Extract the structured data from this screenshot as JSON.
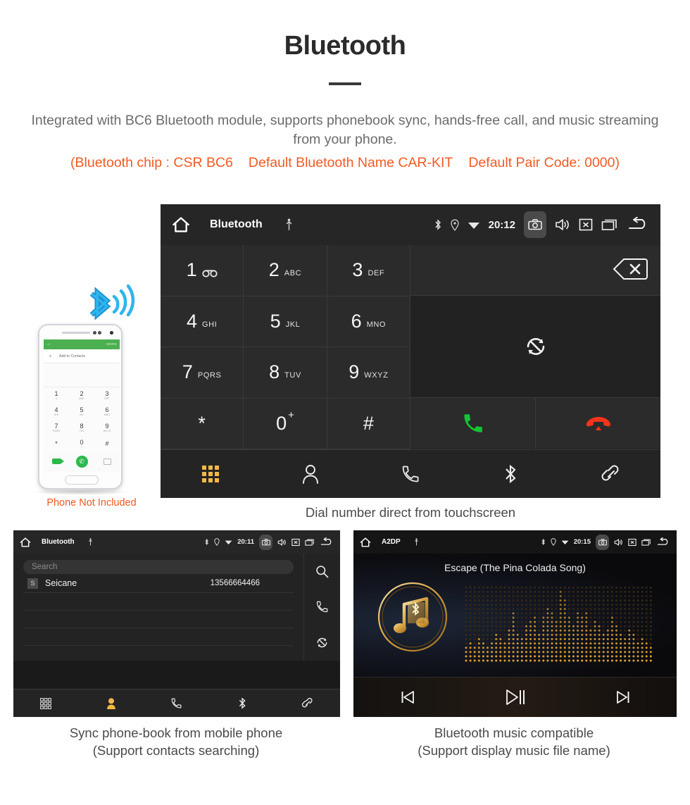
{
  "header": {
    "title": "Bluetooth",
    "subtitle": "Integrated with BC6 Bluetooth module, supports phonebook sync, hands-free call, and music streaming from your phone.",
    "spec_chip": "(Bluetooth chip : CSR BC6",
    "spec_name": "Default Bluetooth Name CAR-KIT",
    "spec_pair": "Default Pair Code: 0000)",
    "accent_color": "#f05a22",
    "subtitle_color": "#6b6b6b"
  },
  "phone_mockup": {
    "not_included_label": "Phone Not Included",
    "app_bar_more": "MORE",
    "add_to_contacts": "Add to Contacts",
    "bluetooth_icon_color": "#29a9e0",
    "keys": [
      {
        "num": "1",
        "sub": "∞"
      },
      {
        "num": "2",
        "sub": "ABC"
      },
      {
        "num": "3",
        "sub": "DEF"
      },
      {
        "num": "4",
        "sub": "GHI"
      },
      {
        "num": "5",
        "sub": "JKL"
      },
      {
        "num": "6",
        "sub": "MNO"
      },
      {
        "num": "7",
        "sub": "PQRS"
      },
      {
        "num": "8",
        "sub": "TUV"
      },
      {
        "num": "9",
        "sub": "WXYZ"
      },
      {
        "num": "*",
        "sub": ""
      },
      {
        "num": "0",
        "sub": "+"
      },
      {
        "num": "#",
        "sub": ""
      }
    ]
  },
  "dialer": {
    "statusbar": {
      "title": "Bluetooth",
      "time": "20:12",
      "icons": [
        "home-icon",
        "usb-icon",
        "bluetooth-icon",
        "location-icon",
        "wifi-icon",
        "camera-icon",
        "volume-icon",
        "close-box-icon",
        "recents-icon",
        "back-icon"
      ]
    },
    "keys": [
      {
        "num": "1",
        "sub": "voicemail"
      },
      {
        "num": "2",
        "sub": "ABC"
      },
      {
        "num": "3",
        "sub": "DEF"
      },
      {
        "num": "4",
        "sub": "GHI"
      },
      {
        "num": "5",
        "sub": "JKL"
      },
      {
        "num": "6",
        "sub": "MNO"
      },
      {
        "num": "7",
        "sub": "PQRS"
      },
      {
        "num": "8",
        "sub": "TUV"
      },
      {
        "num": "9",
        "sub": "WXYZ"
      },
      {
        "num": "*",
        "sub": ""
      },
      {
        "num": "0",
        "sub": "+"
      },
      {
        "num": "#",
        "sub": ""
      }
    ],
    "number_display": "",
    "actions": {
      "backspace": "backspace-icon",
      "transfer": "transfer-call-icon",
      "call": "call-button",
      "hangup": "hangup-button",
      "call_color": "#12c531",
      "hangup_color": "#f4341b"
    },
    "navbar": [
      {
        "name": "keypad",
        "icon": "keypad-icon",
        "active": true
      },
      {
        "name": "contacts",
        "icon": "person-icon",
        "active": false
      },
      {
        "name": "call-log",
        "icon": "phone-handset-icon",
        "active": false
      },
      {
        "name": "bluetooth",
        "icon": "bluetooth-icon",
        "active": false
      },
      {
        "name": "link",
        "icon": "link-icon",
        "active": false
      }
    ],
    "active_color": "#f2b846",
    "caption": "Dial number direct from touchscreen"
  },
  "contacts": {
    "statusbar": {
      "title": "Bluetooth",
      "time": "20:11"
    },
    "search_placeholder": "Search",
    "rows": [
      {
        "initial": "S",
        "name": "Seicane",
        "number": "13566664466"
      }
    ],
    "side_actions": [
      "search-icon",
      "call-icon",
      "sync-icon"
    ],
    "navbar": [
      {
        "name": "keypad",
        "icon": "keypad-icon",
        "active": false
      },
      {
        "name": "contacts",
        "icon": "person-icon",
        "active": true
      },
      {
        "name": "call-log",
        "icon": "phone-handset-icon",
        "active": false
      },
      {
        "name": "bluetooth",
        "icon": "bluetooth-icon",
        "active": false
      },
      {
        "name": "link",
        "icon": "link-icon",
        "active": false
      }
    ],
    "caption_line1": "Sync phone-book from mobile phone",
    "caption_line2": "(Support contacts searching)"
  },
  "music": {
    "statusbar": {
      "title": "A2DP",
      "time": "20:15"
    },
    "track_title": "Escape (The Pina Colada Song)",
    "controls": [
      {
        "name": "previous",
        "icon": "skip-previous-icon"
      },
      {
        "name": "play-pause",
        "icon": "play-pause-icon"
      },
      {
        "name": "next",
        "icon": "skip-next-icon"
      }
    ],
    "accent_gold": "#d6a03c",
    "caption_line1": "Bluetooth music compatible",
    "caption_line2": "(Support display music file name)"
  }
}
